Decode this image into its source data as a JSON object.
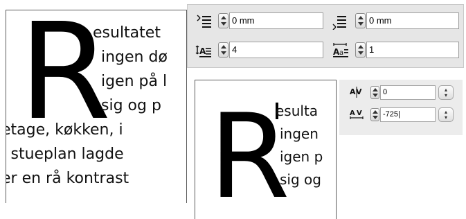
{
  "left_frame": {
    "dropcap": "R",
    "lines": [
      "esultatet",
      "ingen dø",
      "igen på l",
      "sig og p",
      "etage, køkken, i",
      "I stueplan lagde",
      "er en rå kontrast"
    ]
  },
  "paragraph_panel": {
    "left_indent": "0 mm",
    "right_indent": "0 mm",
    "drop_cap_lines": "4",
    "drop_cap_chars": "1"
  },
  "right_frame": {
    "dropcap": "R",
    "lines": [
      "esulta",
      "ingen",
      "igen p",
      "sig og"
    ]
  },
  "kerning_panel": {
    "kerning_value": "0",
    "tracking_value": "-725|"
  }
}
